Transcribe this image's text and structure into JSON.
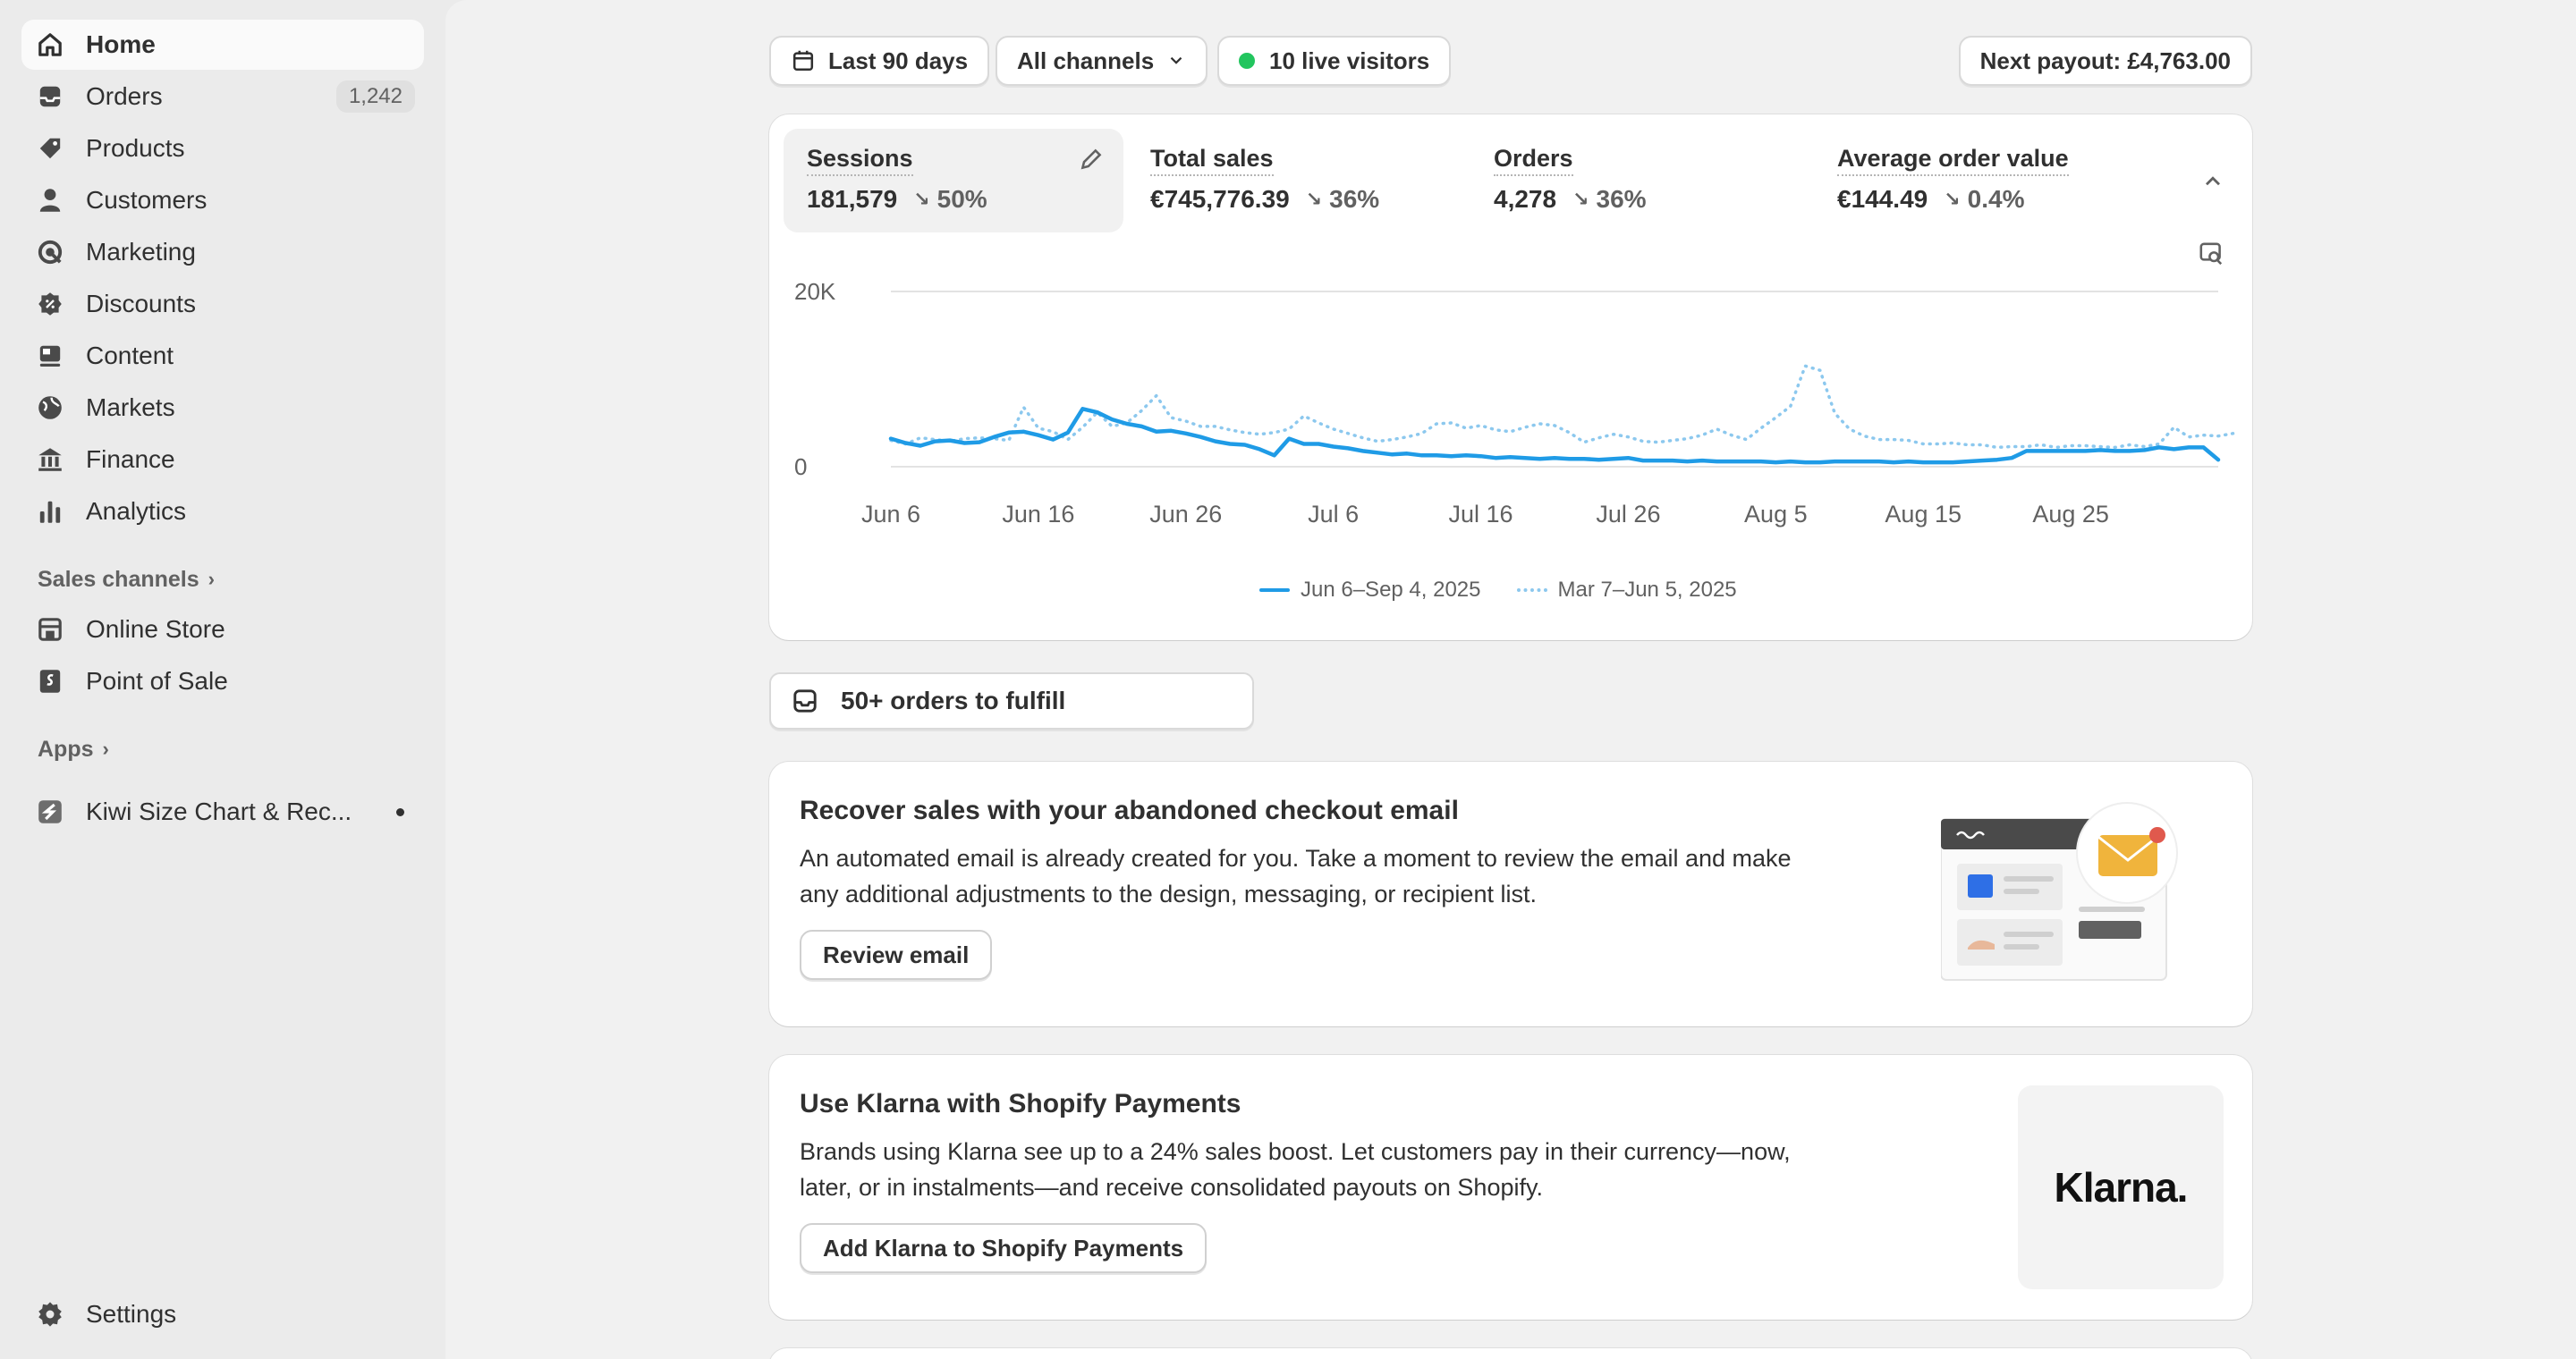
{
  "sidebar": {
    "items": [
      {
        "label": "Home",
        "icon": "home-icon"
      },
      {
        "label": "Orders",
        "icon": "orders-icon",
        "badge": "1,242"
      },
      {
        "label": "Products",
        "icon": "tag-icon"
      },
      {
        "label": "Customers",
        "icon": "person-icon"
      },
      {
        "label": "Marketing",
        "icon": "target-icon"
      },
      {
        "label": "Discounts",
        "icon": "discount-icon"
      },
      {
        "label": "Content",
        "icon": "content-icon"
      },
      {
        "label": "Markets",
        "icon": "globe-icon"
      },
      {
        "label": "Finance",
        "icon": "bank-icon"
      },
      {
        "label": "Analytics",
        "icon": "bar-chart-icon"
      }
    ],
    "sales_channels_label": "Sales channels",
    "channels": [
      {
        "label": "Online Store",
        "icon": "store-icon"
      },
      {
        "label": "Point of Sale",
        "icon": "pos-icon"
      }
    ],
    "apps_label": "Apps",
    "apps": [
      {
        "label": "Kiwi Size Chart & Rec...",
        "icon": "kiwi-app-icon"
      }
    ],
    "settings_label": "Settings"
  },
  "topbar": {
    "date_range": "Last 90 days",
    "channels": "All channels",
    "live_visitors": "10 live visitors",
    "payout": "Next payout: £4,763.00"
  },
  "metrics": [
    {
      "title": "Sessions",
      "value": "181,579",
      "delta": "50%"
    },
    {
      "title": "Total sales",
      "value": "€745,776.39",
      "delta": "36%"
    },
    {
      "title": "Orders",
      "value": "4,278",
      "delta": "36%"
    },
    {
      "title": "Average order value",
      "value": "€144.49",
      "delta": "0.4%"
    }
  ],
  "chart_data": {
    "type": "line",
    "yticks": [
      "20K",
      "0"
    ],
    "ylim": [
      0,
      20000
    ],
    "xticks": [
      "Jun 6",
      "Jun 16",
      "Jun 26",
      "Jul 6",
      "Jul 16",
      "Jul 26",
      "Aug 5",
      "Aug 15",
      "Aug 25"
    ],
    "grid": true,
    "legend_position": "bottom-center",
    "series": [
      {
        "name": "Jun 6–Sep 4, 2025",
        "style": "solid",
        "color": "#1f9be6",
        "values": [
          3200,
          2700,
          2400,
          2900,
          3000,
          2700,
          2800,
          3400,
          3900,
          4000,
          3600,
          3100,
          3900,
          6600,
          6200,
          5400,
          4900,
          4600,
          4000,
          4100,
          3800,
          3400,
          2900,
          2600,
          2500,
          2000,
          1300,
          3200,
          2600,
          2600,
          2300,
          2100,
          1800,
          1600,
          1400,
          1500,
          1300,
          1300,
          1200,
          1300,
          1200,
          1000,
          1100,
          1000,
          900,
          1000,
          900,
          900,
          800,
          900,
          1000,
          700,
          700,
          700,
          600,
          700,
          600,
          600,
          600,
          600,
          500,
          600,
          500,
          500,
          600,
          600,
          600,
          600,
          500,
          600,
          500,
          500,
          500,
          600,
          700,
          800,
          1000,
          1800,
          1800,
          1800,
          1800,
          1800,
          1900,
          1800,
          1800,
          1900,
          2200,
          2000,
          2200,
          2200,
          800
        ]
      },
      {
        "name": "Mar 7–Jun 5, 2025",
        "style": "dotted",
        "color": "#8cc8ee",
        "values": [
          3000,
          2600,
          3300,
          3100,
          2900,
          3200,
          3300,
          3200,
          3000,
          6800,
          4400,
          4000,
          3100,
          4500,
          6200,
          4600,
          5000,
          6400,
          8100,
          5600,
          5200,
          4600,
          4600,
          4200,
          3900,
          3700,
          3900,
          4300,
          5800,
          5000,
          4300,
          3800,
          3300,
          2900,
          3100,
          3400,
          3800,
          4900,
          5000,
          4400,
          4700,
          4200,
          4000,
          4500,
          4900,
          4700,
          3900,
          2800,
          3300,
          3700,
          3400,
          2900,
          2800,
          3000,
          3200,
          3600,
          4300,
          3600,
          3100,
          4400,
          5600,
          6900,
          11500,
          11000,
          6100,
          4300,
          3500,
          3100,
          3100,
          3000,
          2600,
          2600,
          2700,
          2500,
          2500,
          2200,
          2300,
          2300,
          2500,
          2200,
          2400,
          2400,
          2300,
          2200,
          2500,
          2300,
          2600,
          4500,
          3400,
          3600,
          3500,
          3800
        ]
      }
    ]
  },
  "fulfill": {
    "label": "50+ orders to fulfill"
  },
  "cards": [
    {
      "title": "Recover sales with your abandoned checkout email",
      "body": "An automated email is already created for you. Take a moment to review the email and make any additional adjustments to the design, messaging, or recipient list.",
      "button": "Review email"
    },
    {
      "title": "Use Klarna with Shopify Payments",
      "body": "Brands using Klarna see up to a 24% sales boost. Let customers pay in their currency—now, later, or in instalments—and receive consolidated payouts on Shopify.",
      "button": "Add Klarna to Shopify Payments",
      "logo": "Klarna."
    }
  ]
}
